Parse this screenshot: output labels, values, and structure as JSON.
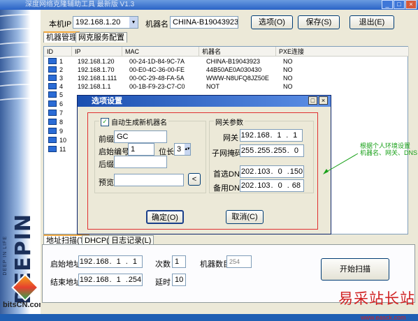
{
  "app": {
    "title": "深度网络克隆辅助工具 最新版 V1.3"
  },
  "header": {
    "local_ip_label": "本机IP",
    "local_ip_value": "192.168.1.20",
    "machine_name_label": "机器名",
    "machine_name_value": "CHINA-B19043923",
    "options_button": "选项(O)",
    "save_button": "保存(S)",
    "exit_button": "退出(E)"
  },
  "top_tabs": [
    {
      "label": "机器管理"
    },
    {
      "label": "网克服务配置"
    }
  ],
  "table": {
    "columns": [
      "ID",
      "IP",
      "MAC",
      "机器名",
      "PXE连接"
    ],
    "rows": [
      {
        "id": "1",
        "ip": "192.168.1.20",
        "mac": "00-24-1D-84-9C-7A",
        "name": "CHINA-B19043923",
        "pxe": "NO"
      },
      {
        "id": "2",
        "ip": "192.168.1.70",
        "mac": "00-E0-4C-36-00-FE",
        "name": "44B50AE0A030430",
        "pxe": "NO"
      },
      {
        "id": "3",
        "ip": "192.168.1.111",
        "mac": "00-0C-29-48-FA-5A",
        "name": "WWW-N8UFQ8JZ50E",
        "pxe": "NO"
      },
      {
        "id": "4",
        "ip": "192.168.1.1",
        "mac": "00-1B-F9-23-C7-C0",
        "name": "NOT",
        "pxe": "NO"
      },
      {
        "id": "5",
        "ip": "",
        "mac": "",
        "name": "",
        "pxe": ""
      },
      {
        "id": "6",
        "ip": "",
        "mac": "",
        "name": "",
        "pxe": ""
      },
      {
        "id": "7",
        "ip": "",
        "mac": "",
        "name": "",
        "pxe": ""
      },
      {
        "id": "8",
        "ip": "",
        "mac": "",
        "name": "",
        "pxe": ""
      },
      {
        "id": "9",
        "ip": "",
        "mac": "",
        "name": "",
        "pxe": ""
      },
      {
        "id": "10",
        "ip": "",
        "mac": "",
        "name": "",
        "pxe": ""
      },
      {
        "id": "11",
        "ip": "",
        "mac": "",
        "name": "",
        "pxe": ""
      }
    ]
  },
  "dialog": {
    "title": "选项设置",
    "auto_gen_label": "自动生成新机器名",
    "auto_gen_checked": true,
    "prefix_label": "前缀",
    "prefix_value": "GC",
    "start_num_label": "启始编号",
    "start_num_value": "1",
    "digits_label": "位长",
    "digits_value": "3",
    "suffix_label": "后缀",
    "suffix_value": "",
    "preview_label": "预览",
    "preview_value": "",
    "preview_button": "<",
    "gateway_group": "网关参数",
    "gateway_label": "网关",
    "gateway": [
      "192",
      "168",
      "1",
      "1"
    ],
    "mask_label": "子网掩码",
    "mask": [
      "255",
      "255",
      "255",
      "0"
    ],
    "dns1_label": "首选DNS",
    "dns1": [
      "202",
      "103",
      "0",
      "150"
    ],
    "dns2_label": "备用DNS",
    "dns2": [
      "202",
      "103",
      "0",
      "68"
    ],
    "ok_button": "确定(O)",
    "cancel_button": "取消(C)"
  },
  "annotation": {
    "line1": "根据个人环境设置",
    "line2": "机器名、网关、DNS"
  },
  "bottom_tabs": [
    {
      "label": "地址扫描(T)"
    },
    {
      "label": "DHCP(D)"
    },
    {
      "label": "日志记录(L)"
    }
  ],
  "scan": {
    "start_label": "启始地址",
    "start_ip": [
      "192",
      "168",
      "1",
      "1"
    ],
    "end_label": "结束地址",
    "end_ip": [
      "192",
      "168",
      "1",
      "254"
    ],
    "count_label": "次数",
    "count_value": "1",
    "delay_label": "延时",
    "delay_value": "10",
    "machines_label": "机器数目",
    "machines_value": "254",
    "scan_button": "开始扫描"
  },
  "branding": {
    "deepin": "DEEPIN",
    "deepin_small": "DEEP IN LIFE",
    "site": "bitsCN.com",
    "watermark": "易采站长站",
    "watermark_url": "www.easck.com"
  }
}
